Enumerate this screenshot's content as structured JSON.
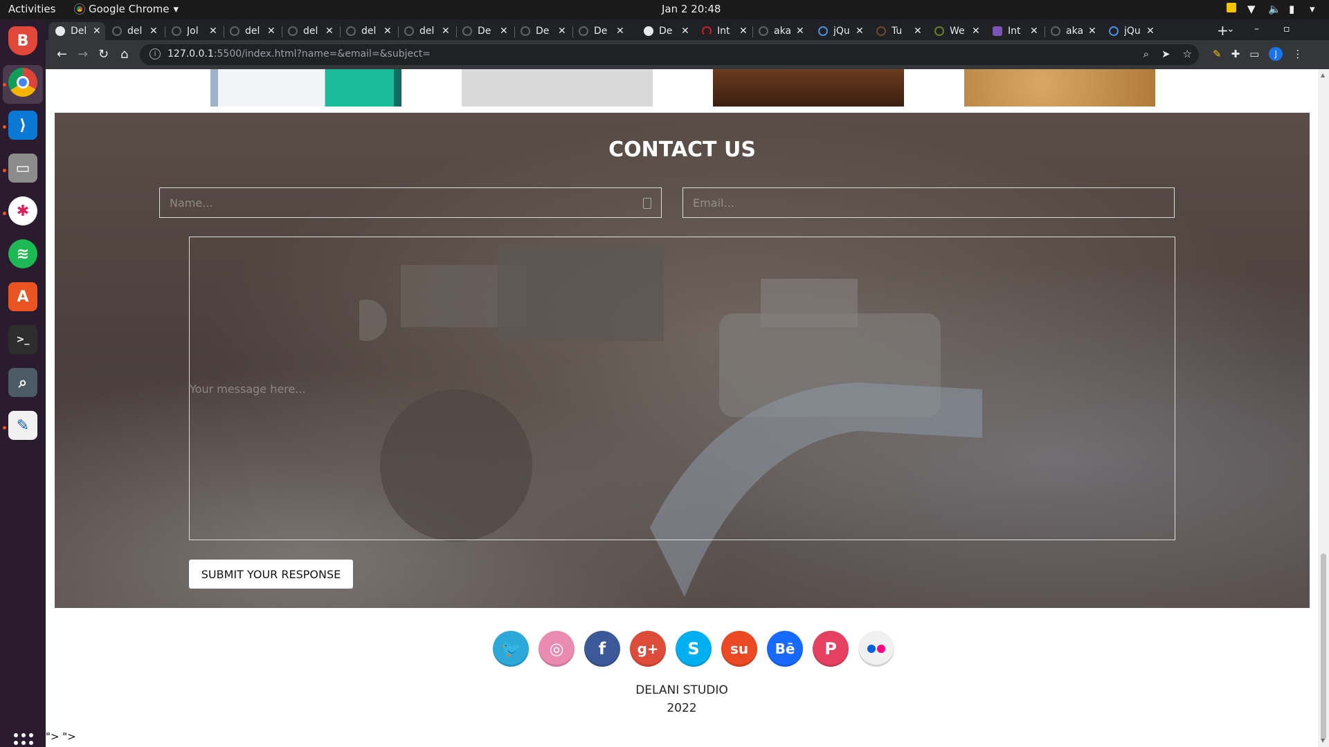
{
  "topbar": {
    "activities": "Activities",
    "app_name": "Google Chrome",
    "clock": "Jan 2  20:48"
  },
  "tabs": [
    {
      "title": "Del",
      "active": true
    },
    {
      "title": "del"
    },
    {
      "title": "Jol"
    },
    {
      "title": "del"
    },
    {
      "title": "del"
    },
    {
      "title": "del"
    },
    {
      "title": "del"
    },
    {
      "title": "De"
    },
    {
      "title": "De"
    },
    {
      "title": "De"
    },
    {
      "title": "De"
    },
    {
      "title": "Int"
    },
    {
      "title": "aka"
    },
    {
      "title": "jQu"
    },
    {
      "title": "Tu"
    },
    {
      "title": "We"
    },
    {
      "title": "Int"
    },
    {
      "title": "aka"
    },
    {
      "title": "jQu"
    }
  ],
  "address": {
    "host": "127.0.0.1",
    "path": ":5500/index.html?name=&email=&subject="
  },
  "profile_initial": "J",
  "contact": {
    "title": "CONTACT US",
    "name_placeholder": "Name...",
    "email_placeholder": "Email...",
    "message_placeholder": "Your message here...",
    "submit_label": "SUBMIT YOUR RESPONSE"
  },
  "social": [
    {
      "name": "twitter",
      "color": "#2da9d9",
      "glyph": "🐦"
    },
    {
      "name": "dribbble",
      "color": "#ea8bb1",
      "glyph": "◎"
    },
    {
      "name": "facebook",
      "color": "#3b5998",
      "glyph": "f"
    },
    {
      "name": "google-plus",
      "color": "#dd4b39",
      "glyph": "g+"
    },
    {
      "name": "skype",
      "color": "#00aff0",
      "glyph": "S"
    },
    {
      "name": "stumbleupon",
      "color": "#eb4924",
      "glyph": "su"
    },
    {
      "name": "behance",
      "color": "#1769ff",
      "glyph": "Bē"
    },
    {
      "name": "pinterest",
      "color": "#e4405f",
      "glyph": "P"
    },
    {
      "name": "flickr",
      "color": "#f0f0f0",
      "glyph": ""
    }
  ],
  "footer": {
    "studio": "DELANI STUDIO",
    "year": "2022"
  },
  "stray_text": "\"> \">"
}
